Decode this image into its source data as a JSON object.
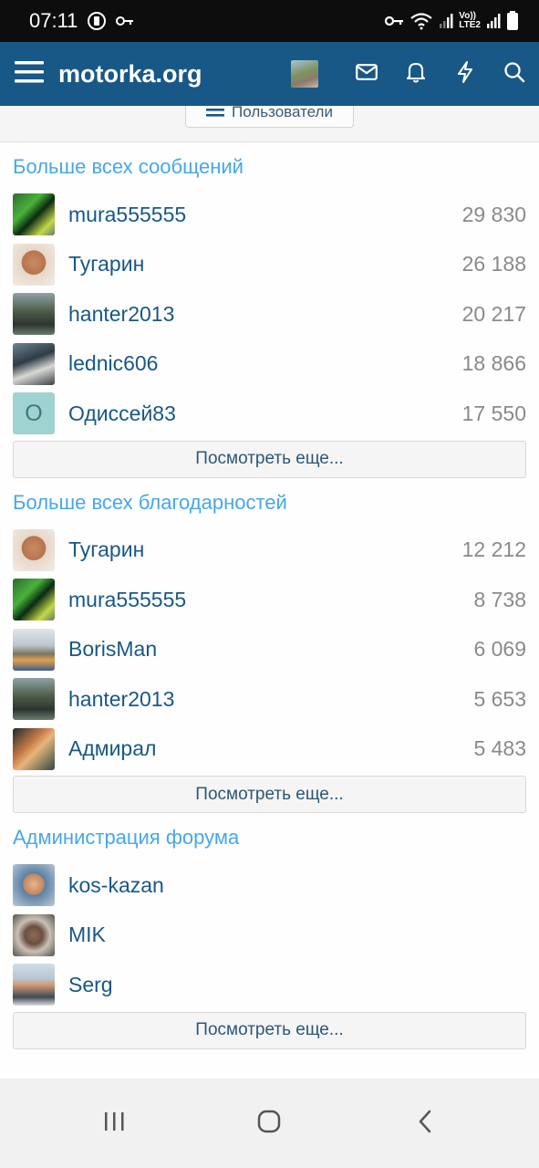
{
  "status_bar": {
    "time": "07:11",
    "network_label_top": "Vo))",
    "network_label_bottom": "LTE2"
  },
  "header": {
    "site_title": "motorka.org"
  },
  "users_button_label": "Пользователи",
  "sections": [
    {
      "title": "Больше всех сообщений",
      "more_label": "Посмотреть еще...",
      "rows": [
        {
          "name": "mura555555",
          "count": "29 830",
          "avatar": "av-green"
        },
        {
          "name": "Тугарин",
          "count": "26 188",
          "avatar": "av-tug"
        },
        {
          "name": "hanter2013",
          "count": "20 217",
          "avatar": "av-hunter"
        },
        {
          "name": "lednic606",
          "count": "18 866",
          "avatar": "av-lednic"
        },
        {
          "name": "Одиссей83",
          "count": "17 550",
          "avatar": "av-letter",
          "letter": "O"
        }
      ]
    },
    {
      "title": "Больше всех благодарностей",
      "more_label": "Посмотреть еще...",
      "rows": [
        {
          "name": "Тугарин",
          "count": "12 212",
          "avatar": "av-tug"
        },
        {
          "name": "mura555555",
          "count": "8 738",
          "avatar": "av-green"
        },
        {
          "name": "BorisMan",
          "count": "6 069",
          "avatar": "av-boris"
        },
        {
          "name": "hanter2013",
          "count": "5 653",
          "avatar": "av-hunter"
        },
        {
          "name": "Адмирал",
          "count": "5 483",
          "avatar": "av-admiral"
        }
      ]
    },
    {
      "title": "Администрация форума",
      "more_label": "Посмотреть еще...",
      "rows": [
        {
          "name": "kos-kazan",
          "count": "",
          "avatar": "av-kos"
        },
        {
          "name": "MIK",
          "count": "",
          "avatar": "av-mik"
        },
        {
          "name": "Serg",
          "count": "",
          "avatar": "av-serg"
        }
      ]
    }
  ],
  "icons": {
    "menu": "hamburger-icon",
    "messages": "envelope-icon",
    "alerts": "bell-icon",
    "whats_new": "bolt-icon",
    "search": "search-icon"
  },
  "colors": {
    "header_bg": "#185886",
    "section_title": "#47a7eb",
    "username": "#185886",
    "count": "#8a8a8a"
  }
}
